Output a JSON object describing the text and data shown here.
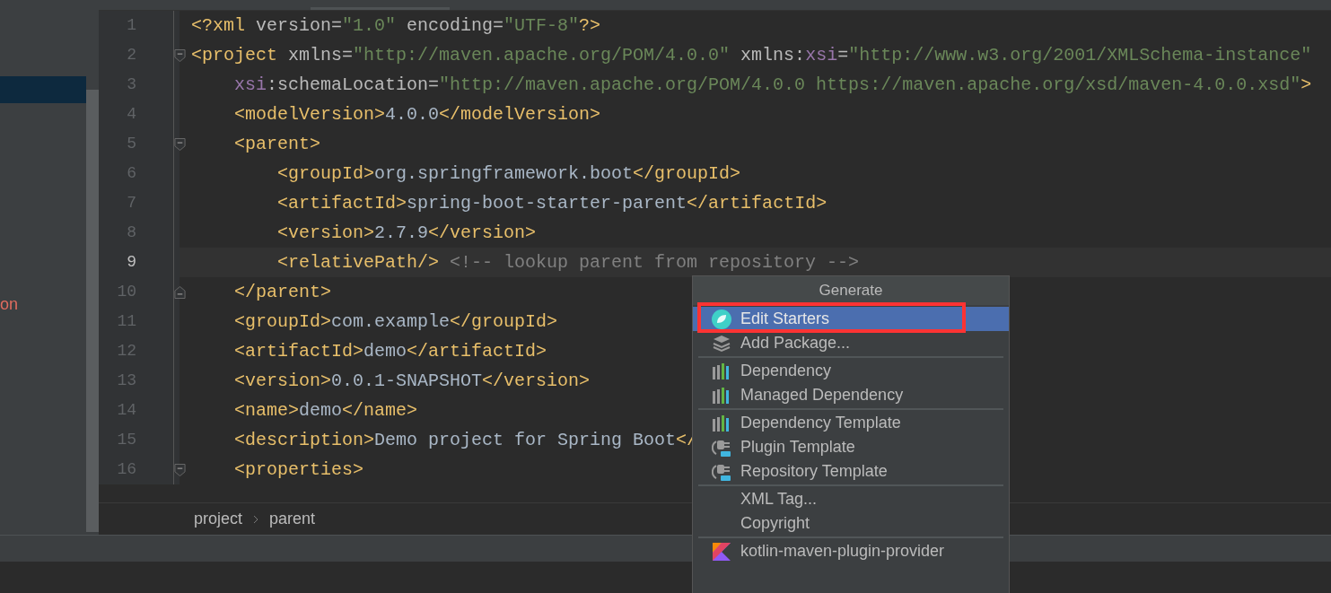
{
  "sidebar": {
    "items": [
      {
        "label": "on",
        "kind": "error"
      }
    ]
  },
  "editor": {
    "lines": [
      {
        "number": "1",
        "current": false,
        "kind": "plain",
        "tokens": [
          {
            "kind": "tag",
            "text": "<?xml"
          },
          {
            "kind": "attr",
            "text": " version="
          },
          {
            "kind": "value",
            "text": "\"1.0\""
          },
          {
            "kind": "attr",
            "text": " encoding="
          },
          {
            "kind": "value",
            "text": "\"UTF-8\""
          },
          {
            "kind": "tag",
            "text": "?>"
          }
        ]
      },
      {
        "number": "2",
        "current": false,
        "kind": "fold-start",
        "tokens": [
          {
            "kind": "tag",
            "text": "<project"
          },
          {
            "kind": "attr",
            "text": " xmlns="
          },
          {
            "kind": "value",
            "text": "\"http://maven.apache.org/POM/4.0.0\""
          },
          {
            "kind": "attr",
            "text": " xmlns:"
          },
          {
            "kind": "ns",
            "text": "xsi"
          },
          {
            "kind": "attr",
            "text": "="
          },
          {
            "kind": "value",
            "text": "\"http://www.w3.org/2001/XMLSchema-instance\""
          }
        ]
      },
      {
        "number": "3",
        "current": false,
        "kind": "plain",
        "tokens": [
          {
            "kind": "ns",
            "text": "    xsi"
          },
          {
            "kind": "attr",
            "text": ":schemaLocation="
          },
          {
            "kind": "value",
            "text": "\"http://maven.apache.org/POM/4.0.0 https://maven.apache.org/xsd/maven-4.0.0.xsd\""
          },
          {
            "kind": "tag",
            "text": ">"
          }
        ]
      },
      {
        "number": "4",
        "current": false,
        "kind": "plain",
        "tokens": [
          {
            "kind": "tag",
            "text": "    <modelVersion>"
          },
          {
            "kind": "text",
            "text": "4.0.0"
          },
          {
            "kind": "tag",
            "text": "</modelVersion>"
          }
        ]
      },
      {
        "number": "5",
        "current": false,
        "kind": "fold-start",
        "tokens": [
          {
            "kind": "tag",
            "text": "    <parent>"
          }
        ]
      },
      {
        "number": "6",
        "current": false,
        "kind": "plain",
        "tokens": [
          {
            "kind": "tag",
            "text": "        <groupId>"
          },
          {
            "kind": "text",
            "text": "org.springframework.boot"
          },
          {
            "kind": "tag",
            "text": "</groupId>"
          }
        ]
      },
      {
        "number": "7",
        "current": false,
        "kind": "plain",
        "tokens": [
          {
            "kind": "tag",
            "text": "        <artifactId>"
          },
          {
            "kind": "text",
            "text": "spring-boot-starter-parent"
          },
          {
            "kind": "tag",
            "text": "</artifactId>"
          }
        ]
      },
      {
        "number": "8",
        "current": false,
        "kind": "plain",
        "tokens": [
          {
            "kind": "tag",
            "text": "        <version>"
          },
          {
            "kind": "text",
            "text": "2.7.9"
          },
          {
            "kind": "tag",
            "text": "</version>"
          }
        ]
      },
      {
        "number": "9",
        "current": true,
        "kind": "plain",
        "tokens": [
          {
            "kind": "tag",
            "text": "        <relativePath/>"
          },
          {
            "kind": "comment",
            "text": " <!-- lookup parent from repository -->"
          }
        ]
      },
      {
        "number": "10",
        "current": false,
        "kind": "fold-end",
        "tokens": [
          {
            "kind": "tag",
            "text": "    </parent>"
          }
        ]
      },
      {
        "number": "11",
        "current": false,
        "kind": "plain",
        "tokens": [
          {
            "kind": "tag",
            "text": "    <groupId>"
          },
          {
            "kind": "text",
            "text": "com.example"
          },
          {
            "kind": "tag",
            "text": "</groupId>"
          }
        ]
      },
      {
        "number": "12",
        "current": false,
        "kind": "plain",
        "tokens": [
          {
            "kind": "tag",
            "text": "    <artifactId>"
          },
          {
            "kind": "text",
            "text": "demo"
          },
          {
            "kind": "tag",
            "text": "</artifactId>"
          }
        ]
      },
      {
        "number": "13",
        "current": false,
        "kind": "plain",
        "tokens": [
          {
            "kind": "tag",
            "text": "    <version>"
          },
          {
            "kind": "text",
            "text": "0.0.1-SNAPSHOT"
          },
          {
            "kind": "tag",
            "text": "</version>"
          }
        ]
      },
      {
        "number": "14",
        "current": false,
        "kind": "plain",
        "tokens": [
          {
            "kind": "tag",
            "text": "    <name>"
          },
          {
            "kind": "text",
            "text": "demo"
          },
          {
            "kind": "tag",
            "text": "</name>"
          }
        ]
      },
      {
        "number": "15",
        "current": false,
        "kind": "plain",
        "tokens": [
          {
            "kind": "tag",
            "text": "    <description>"
          },
          {
            "kind": "text",
            "text": "Demo project for Spring Boot"
          },
          {
            "kind": "tag",
            "text": "</"
          }
        ]
      },
      {
        "number": "16",
        "current": false,
        "kind": "fold-start",
        "tokens": [
          {
            "kind": "tag",
            "text": "    <properties>"
          }
        ]
      }
    ]
  },
  "breadcrumbs": [
    "project",
    "parent"
  ],
  "popup_menu": {
    "items": [
      {
        "kind": "header",
        "label": "Generate"
      },
      {
        "kind": "starter",
        "label": "Edit Starters",
        "selected": true
      },
      {
        "kind": "package",
        "label": "Add Package...",
        "selected": false
      },
      {
        "kind": "separator"
      },
      {
        "kind": "dependency",
        "label": "Dependency",
        "selected": false
      },
      {
        "kind": "dependency",
        "label": "Managed Dependency",
        "selected": false
      },
      {
        "kind": "separator"
      },
      {
        "kind": "dependency",
        "label": "Dependency Template",
        "selected": false
      },
      {
        "kind": "plugin",
        "label": "Plugin Template",
        "selected": false
      },
      {
        "kind": "plugin",
        "label": "Repository Template",
        "selected": false
      },
      {
        "kind": "separator"
      },
      {
        "kind": "text",
        "label": "XML Tag...",
        "selected": false
      },
      {
        "kind": "text",
        "label": "Copyright",
        "selected": false
      },
      {
        "kind": "separator"
      },
      {
        "kind": "kotlin",
        "label": "kotlin-maven-plugin-provider",
        "selected": false
      }
    ]
  }
}
